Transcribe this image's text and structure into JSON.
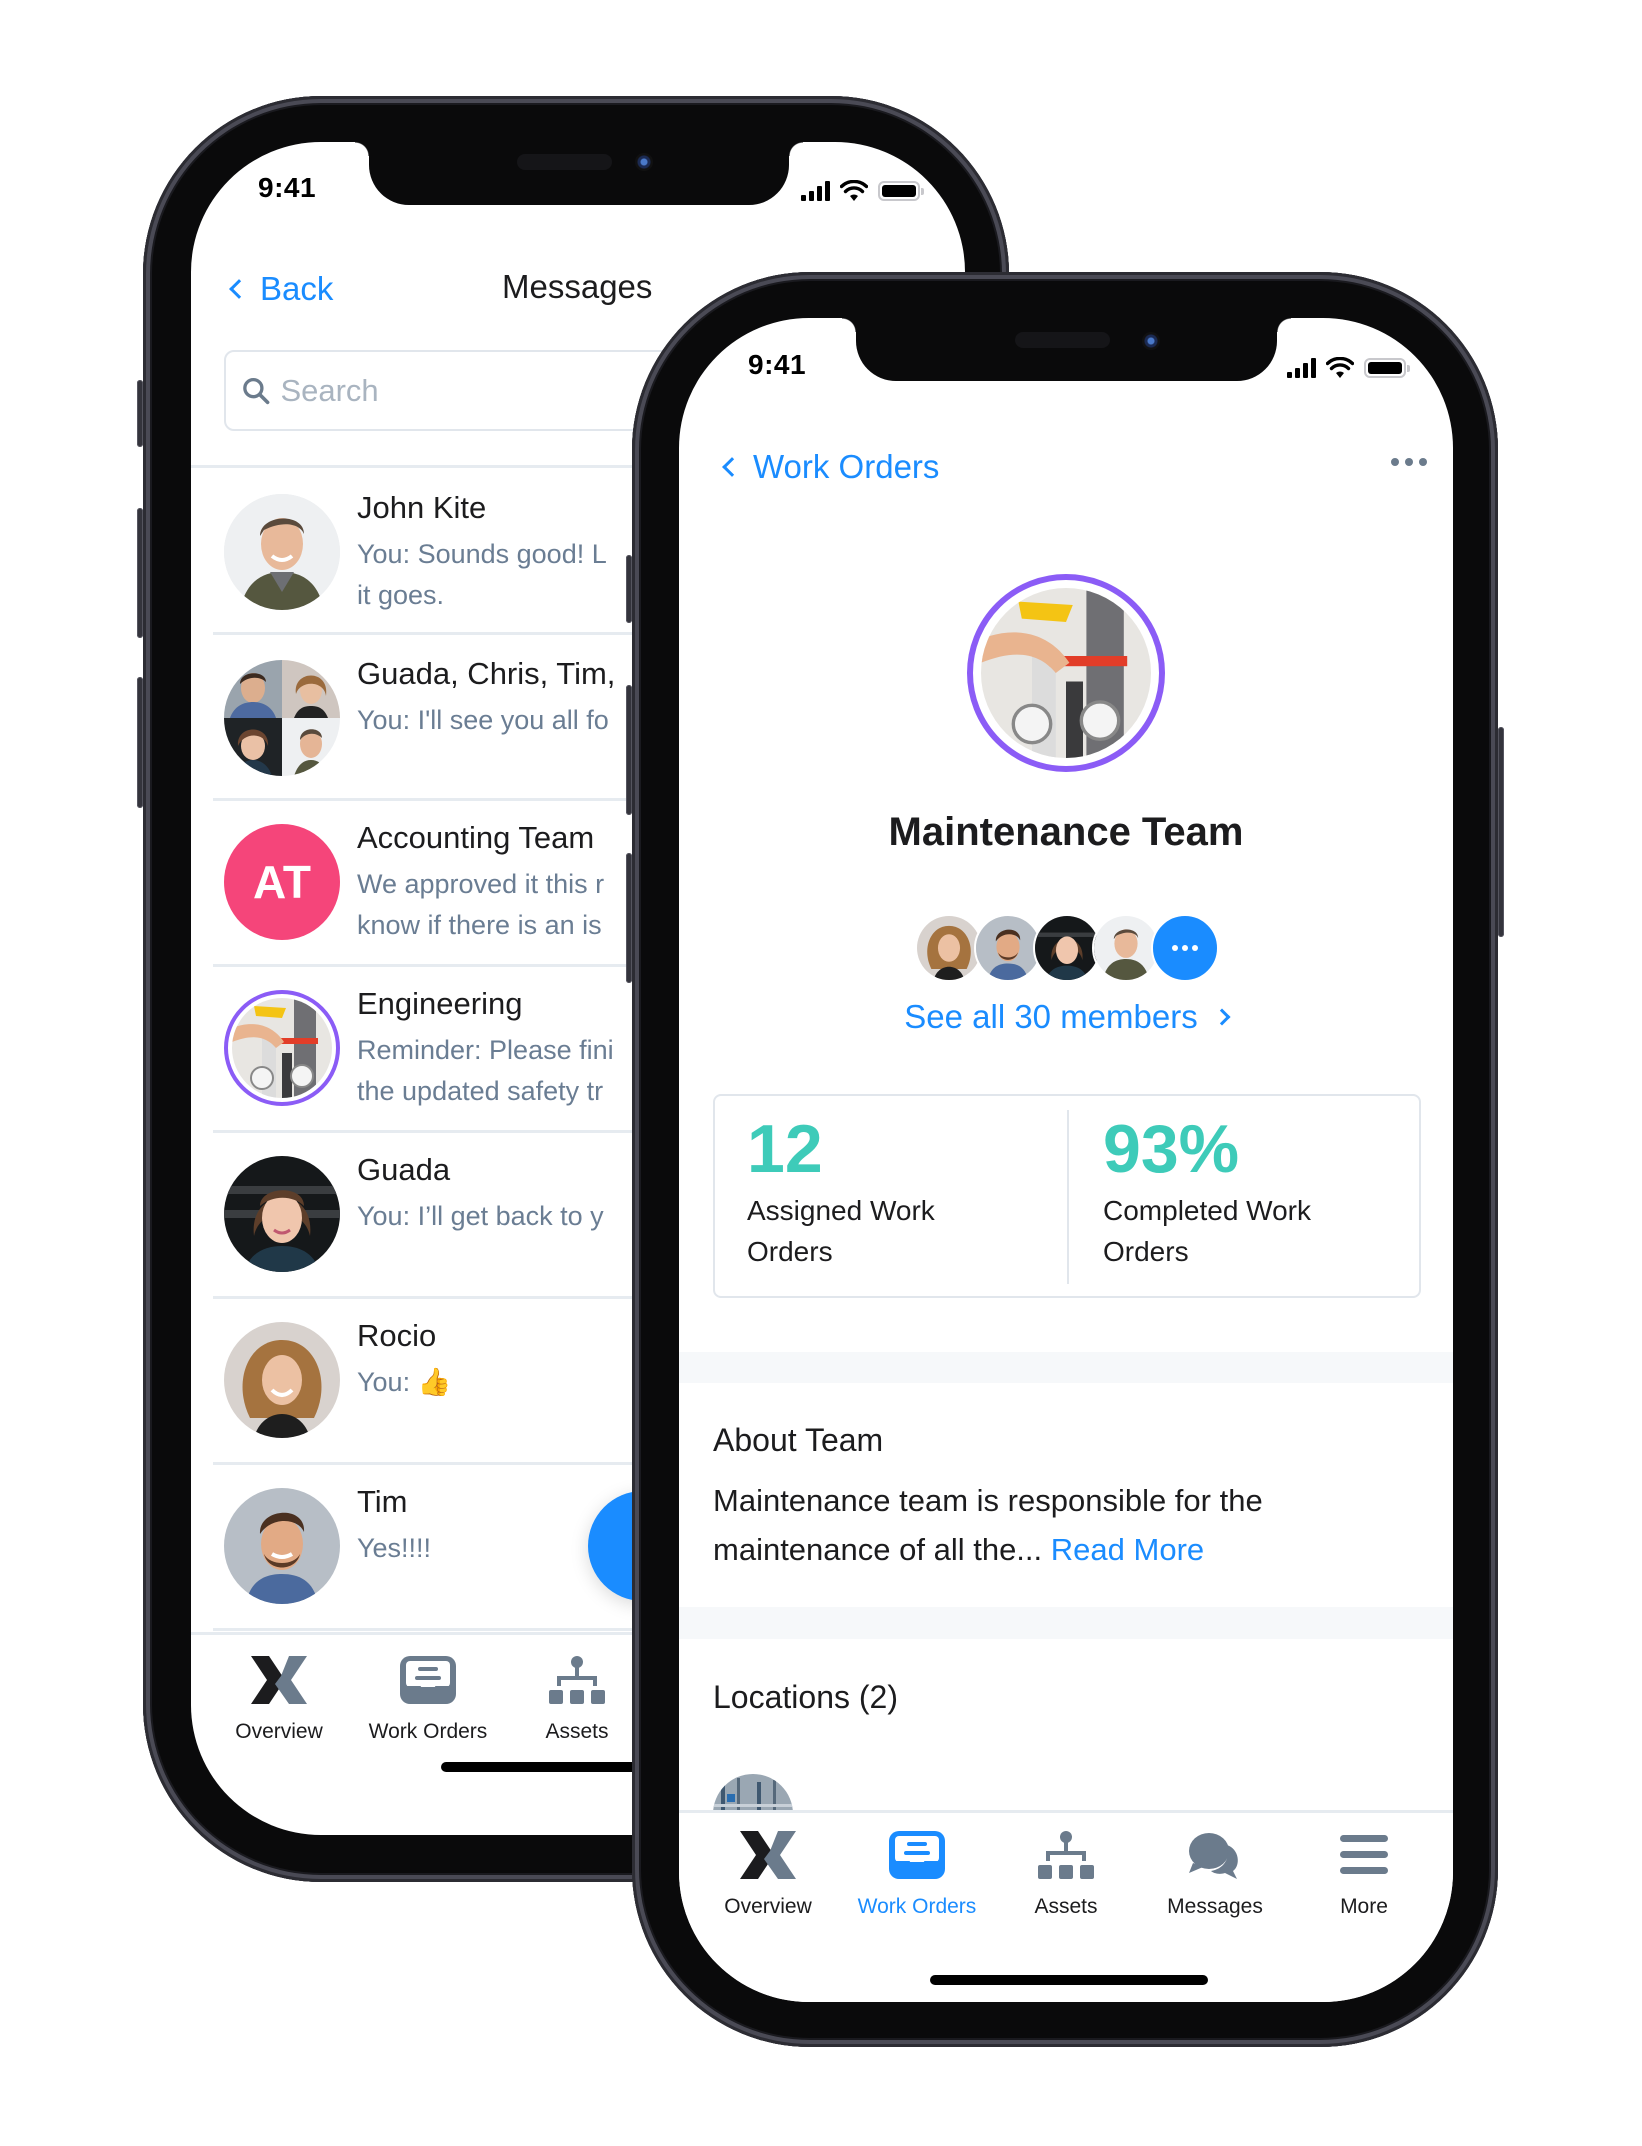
{
  "status_bar": {
    "time": "9:41"
  },
  "messages_screen": {
    "nav": {
      "back_label": "Back",
      "title": "Messages"
    },
    "search": {
      "placeholder": "Search",
      "value": ""
    },
    "conversations": [
      {
        "name": "John Kite",
        "preview_line1": "You: Sounds good! L",
        "preview_line2": "it goes.",
        "avatar": "photo-man-smiling"
      },
      {
        "name": "Guada, Chris, Tim,",
        "preview_line1": "You: I'll see you all fo",
        "preview_line2": "",
        "avatar": "group-photo-collage"
      },
      {
        "name": "Accounting Team",
        "preview_line1": "We approved it this r",
        "preview_line2": "know if there is an is",
        "avatar_initials": "AT",
        "avatar_color": "#f5457a"
      },
      {
        "name": "Engineering",
        "preview_line1": "Reminder: Please fini",
        "preview_line2": "the updated safety tr",
        "avatar": "team-photo-valves",
        "ring_color": "#8b5cf6"
      },
      {
        "name": "Guada",
        "preview_line1": "You: I’ll get back to y",
        "preview_line2": "",
        "avatar": "photo-woman-short-hair"
      },
      {
        "name": "Rocio",
        "preview_line1": "You: 👍",
        "preview_line2": "",
        "avatar": "photo-woman-curly-hair"
      },
      {
        "name": "Tim",
        "preview_line1": "Yes!!!!",
        "preview_line2": "",
        "avatar": "photo-man-beard"
      }
    ],
    "tabbar": [
      {
        "label": "Overview",
        "icon": "x-logo-icon"
      },
      {
        "label": "Work Orders",
        "icon": "inbox-tray-icon"
      },
      {
        "label": "Assets",
        "icon": "hierarchy-icon"
      }
    ]
  },
  "team_screen": {
    "nav": {
      "back_label": "Work Orders",
      "more_icon": "ellipsis-icon"
    },
    "team": {
      "name": "Maintenance Team",
      "avatar": "team-photo-valves",
      "ring_color": "#8b5cf6",
      "members_link": "See all 30 members",
      "member_count": 30
    },
    "stats": [
      {
        "value": "12",
        "label_line1": "Assigned Work",
        "label_line2": "Orders"
      },
      {
        "value": "93%",
        "label_line1": "Completed Work",
        "label_line2": "Orders"
      }
    ],
    "about": {
      "title": "About Team",
      "text_line1": "Maintenance team is responsible for the",
      "text_line2": "maintenance of all the...",
      "read_more": "Read More"
    },
    "locations": {
      "title": "Locations (2)"
    },
    "tabbar": [
      {
        "label": "Overview",
        "icon": "x-logo-icon",
        "active": false
      },
      {
        "label": "Work Orders",
        "icon": "inbox-tray-icon",
        "active": true
      },
      {
        "label": "Assets",
        "icon": "hierarchy-icon",
        "active": false
      },
      {
        "label": "Messages",
        "icon": "chat-bubbles-icon",
        "active": false
      },
      {
        "label": "More",
        "icon": "hamburger-menu-icon",
        "active": false
      }
    ]
  },
  "colors": {
    "accent": "#1a8cff",
    "stat_teal": "#3ecbb9",
    "text_secondary": "#6a7d93",
    "icon_slate": "#6b7b8c",
    "team_ring": "#8b5cf6"
  }
}
